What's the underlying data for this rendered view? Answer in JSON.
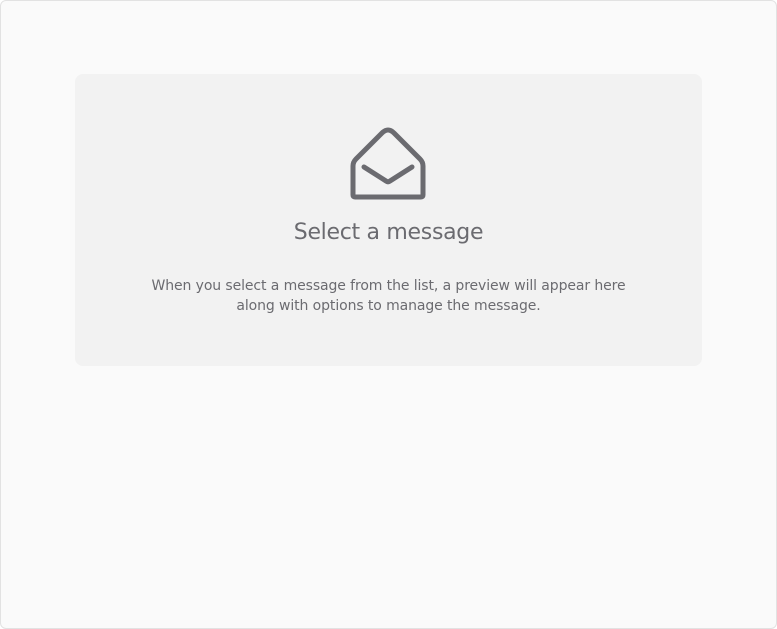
{
  "empty_state": {
    "icon": "envelope-open-icon",
    "title": "Select a message",
    "description_line1": "When you select a message from the list, a preview will appear here",
    "description_line2": "along with options to manage the message."
  },
  "colors": {
    "background": "#fafafa",
    "card": "#f2f2f2",
    "text": "#6b6b70",
    "icon": "#6b6b70"
  }
}
